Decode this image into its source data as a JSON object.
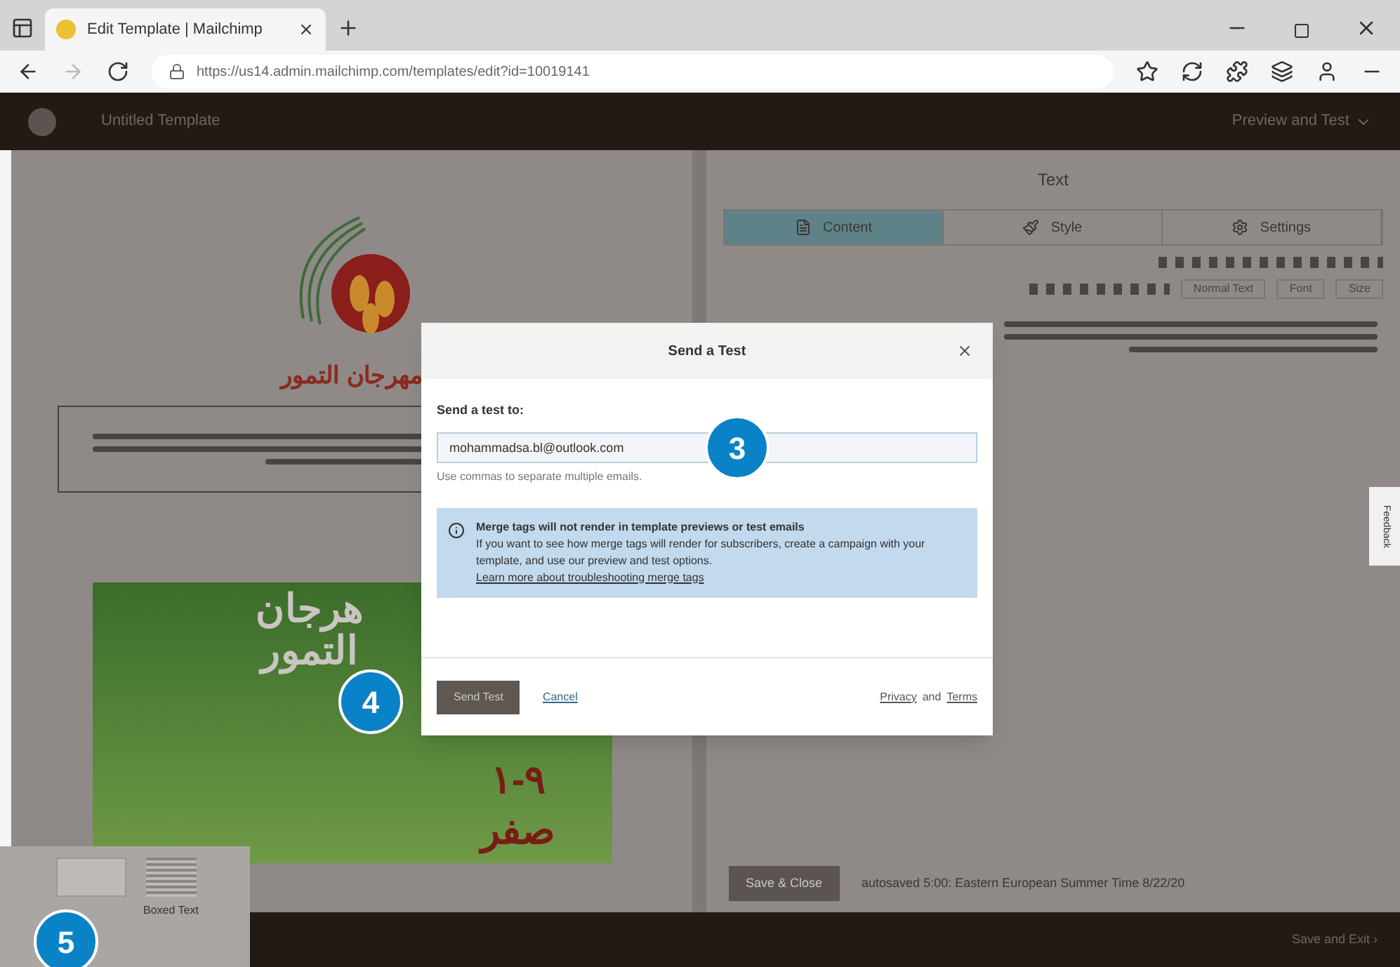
{
  "browser": {
    "tab_title": "Edit Template | Mailchimp",
    "url": "https://us14.admin.mailchimp.com/templates/edit?id=10019141"
  },
  "app_header": {
    "title": "Untitled Template",
    "menu": "Preview and Test"
  },
  "canvas": {
    "logo_title": "مهرجان التمور",
    "poster_lines": [
      "هرجان",
      "التمور"
    ],
    "poster_dates": "٩-١",
    "poster_month": "صفر"
  },
  "panel": {
    "title": "Text",
    "tabs": [
      {
        "label": "Content",
        "selected": true
      },
      {
        "label": "Style",
        "selected": false
      },
      {
        "label": "Settings",
        "selected": false
      }
    ],
    "format_select": "Normal Text",
    "font_select": "Font",
    "size_select": "Size",
    "save_button": "Save & Close",
    "autosave": "autosaved 5:00: Eastern European Summer Time 8/22/20"
  },
  "feedback_tab": "Feedback",
  "footer": {
    "save_exit": "Save and Exit ›"
  },
  "inset": {
    "label": "Boxed Text"
  },
  "dialog": {
    "title": "Send a Test",
    "field_label": "Send a test to:",
    "email": "mohammadsa.bl@outlook.com",
    "hint": "Use commas to separate multiple emails.",
    "notice_title": "Merge tags will not render in template previews or test emails",
    "notice_body": "If you want to see how merge tags will render for subscribers, create a campaign with your template, and use our preview and test options.",
    "notice_link": "Learn more about troubleshooting merge tags",
    "send_button": "Send Test",
    "cancel": "Cancel",
    "privacy": "Privacy",
    "and": "and",
    "terms": "Terms"
  },
  "callouts": [
    {
      "number": "3"
    },
    {
      "number": "4"
    },
    {
      "number": "5"
    }
  ]
}
